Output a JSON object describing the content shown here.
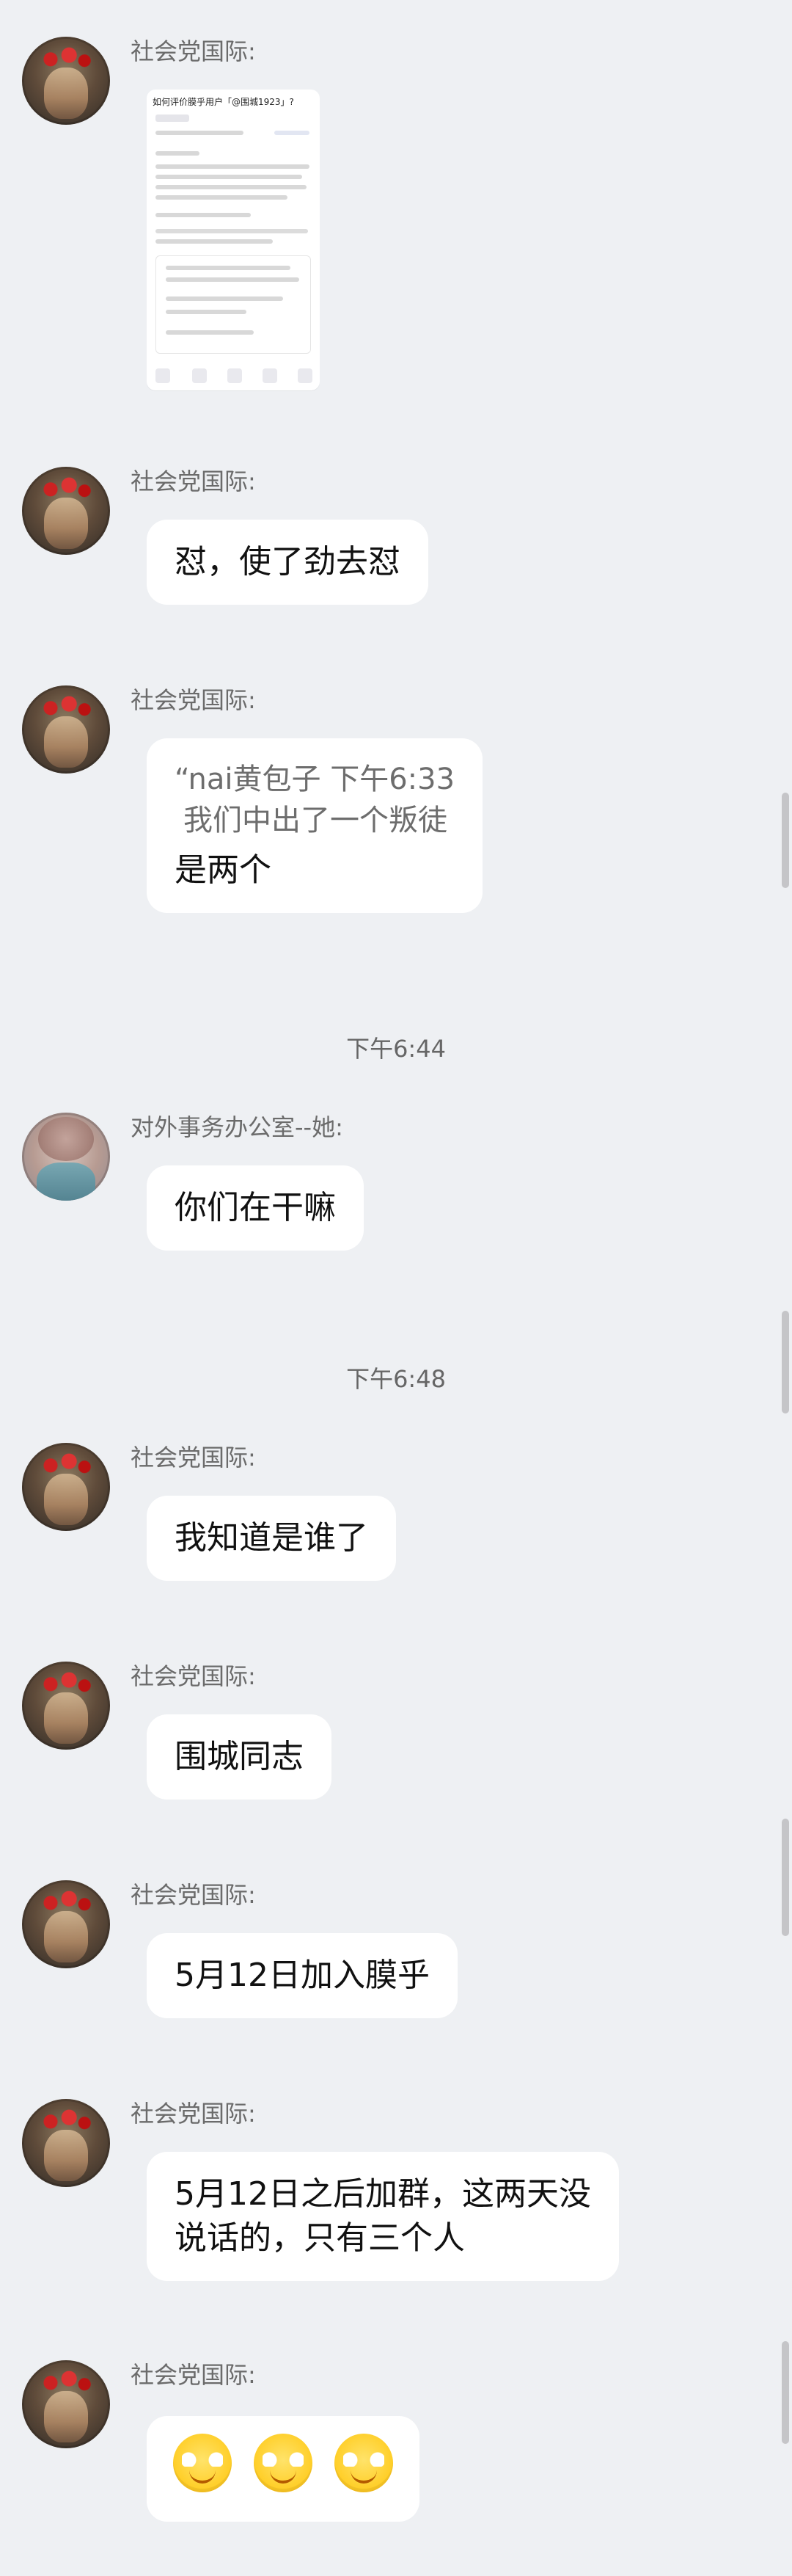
{
  "messages": [
    {
      "sender": "社会党国际:",
      "type": "image",
      "image": {
        "title": "如何评价膜乎用户「@围城1923」?"
      }
    },
    {
      "sender": "社会党国际:",
      "text": "怼，使了劲去怼"
    },
    {
      "sender": "社会党国际:",
      "quote": [
        "“nai黄包子 下午6:33",
        "我们中出了一个叛徒"
      ],
      "text": "是两个"
    },
    {
      "time": "下午6:44"
    },
    {
      "sender": "对外事务办公室--她:",
      "text": "你们在干嘛"
    },
    {
      "time": "下午6:48"
    },
    {
      "sender": "社会党国际:",
      "text": "我知道是谁了"
    },
    {
      "sender": "社会党国际:",
      "text": "围城同志"
    },
    {
      "sender": "社会党国际:",
      "text": "5月12日加入膜乎"
    },
    {
      "sender": "社会党国际:",
      "text": [
        "5月12日之后加群，这两天没",
        "说话的，只有三个人"
      ]
    },
    {
      "sender": "社会党国际:",
      "emoji": [
        "smirk-emoji",
        "smirk-emoji",
        "smirk-emoji"
      ]
    }
  ]
}
